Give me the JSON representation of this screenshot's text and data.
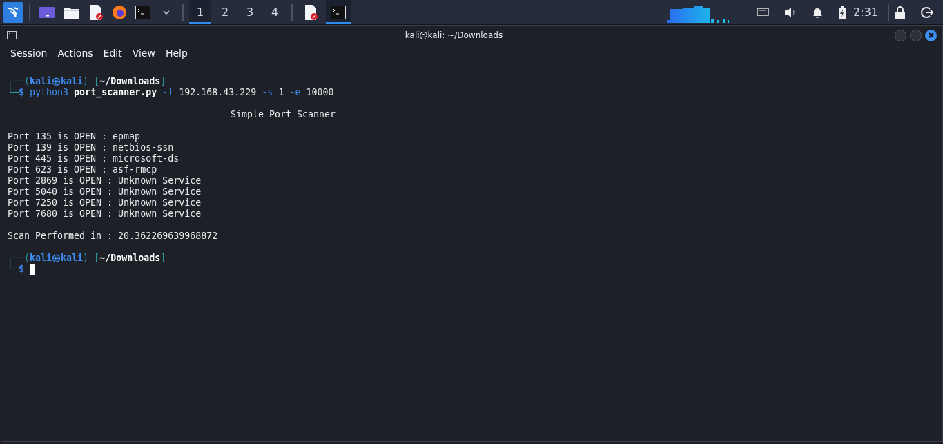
{
  "taskbar": {
    "launchers": [
      {
        "kind": "desktop"
      },
      {
        "kind": "files"
      },
      {
        "kind": "editor"
      },
      {
        "kind": "browser"
      },
      {
        "kind": "terminal"
      }
    ],
    "workspaces": [
      {
        "label": "1",
        "selected": true
      },
      {
        "label": "2",
        "selected": false
      },
      {
        "label": "3",
        "selected": false
      },
      {
        "label": "4",
        "selected": false
      }
    ],
    "tasks": [
      {
        "kind": "editor",
        "selected": false
      },
      {
        "kind": "terminal",
        "selected": true
      }
    ],
    "clock": "2:31"
  },
  "window": {
    "title": "kali@kali: ~/Downloads",
    "menu": [
      "Session",
      "Actions",
      "Edit",
      "View",
      "Help"
    ]
  },
  "terminal": {
    "lines": [
      {
        "kind": "prompt",
        "corner": "┌──(",
        "user": "kali",
        "at": "㉿",
        "host": "kali",
        "mid": ")-[",
        "path": "~/Downloads",
        "end": "]"
      },
      {
        "kind": "command",
        "corner": "└─",
        "symbol": "$",
        "tokens": [
          {
            "text": "python3",
            "kind": "program"
          },
          {
            "text": "port_scanner.py",
            "kind": "file"
          },
          {
            "text": "-t",
            "kind": "flag"
          },
          {
            "text": "192.168.43.229",
            "kind": "arg"
          },
          {
            "text": "-s",
            "kind": "flag"
          },
          {
            "text": "1",
            "kind": "arg"
          },
          {
            "text": "-e",
            "kind": "flag"
          },
          {
            "text": "10000",
            "kind": "arg"
          }
        ]
      },
      {
        "kind": "rule"
      },
      {
        "kind": "title",
        "text": "Simple Port Scanner"
      },
      {
        "kind": "rule"
      },
      {
        "kind": "output",
        "text": "Port 135 is OPEN : epmap"
      },
      {
        "kind": "output",
        "text": "Port 139 is OPEN : netbios-ssn"
      },
      {
        "kind": "output",
        "text": "Port 445 is OPEN : microsoft-ds"
      },
      {
        "kind": "output",
        "text": "Port 623 is OPEN : asf-rmcp"
      },
      {
        "kind": "output",
        "text": "Port 2869 is OPEN : Unknown Service"
      },
      {
        "kind": "output",
        "text": "Port 5040 is OPEN : Unknown Service"
      },
      {
        "kind": "output",
        "text": "Port 7250 is OPEN : Unknown Service"
      },
      {
        "kind": "output",
        "text": "Port 7680 is OPEN : Unknown Service"
      },
      {
        "kind": "blank"
      },
      {
        "kind": "output",
        "text": "Scan Performed in : 20.362269639968872"
      },
      {
        "kind": "blank"
      },
      {
        "kind": "prompt",
        "corner": "┌──(",
        "user": "kali",
        "at": "㉿",
        "host": "kali",
        "mid": ")-[",
        "path": "~/Downloads",
        "end": "]"
      },
      {
        "kind": "cursor",
        "corner": "└─",
        "symbol": "$"
      }
    ]
  }
}
